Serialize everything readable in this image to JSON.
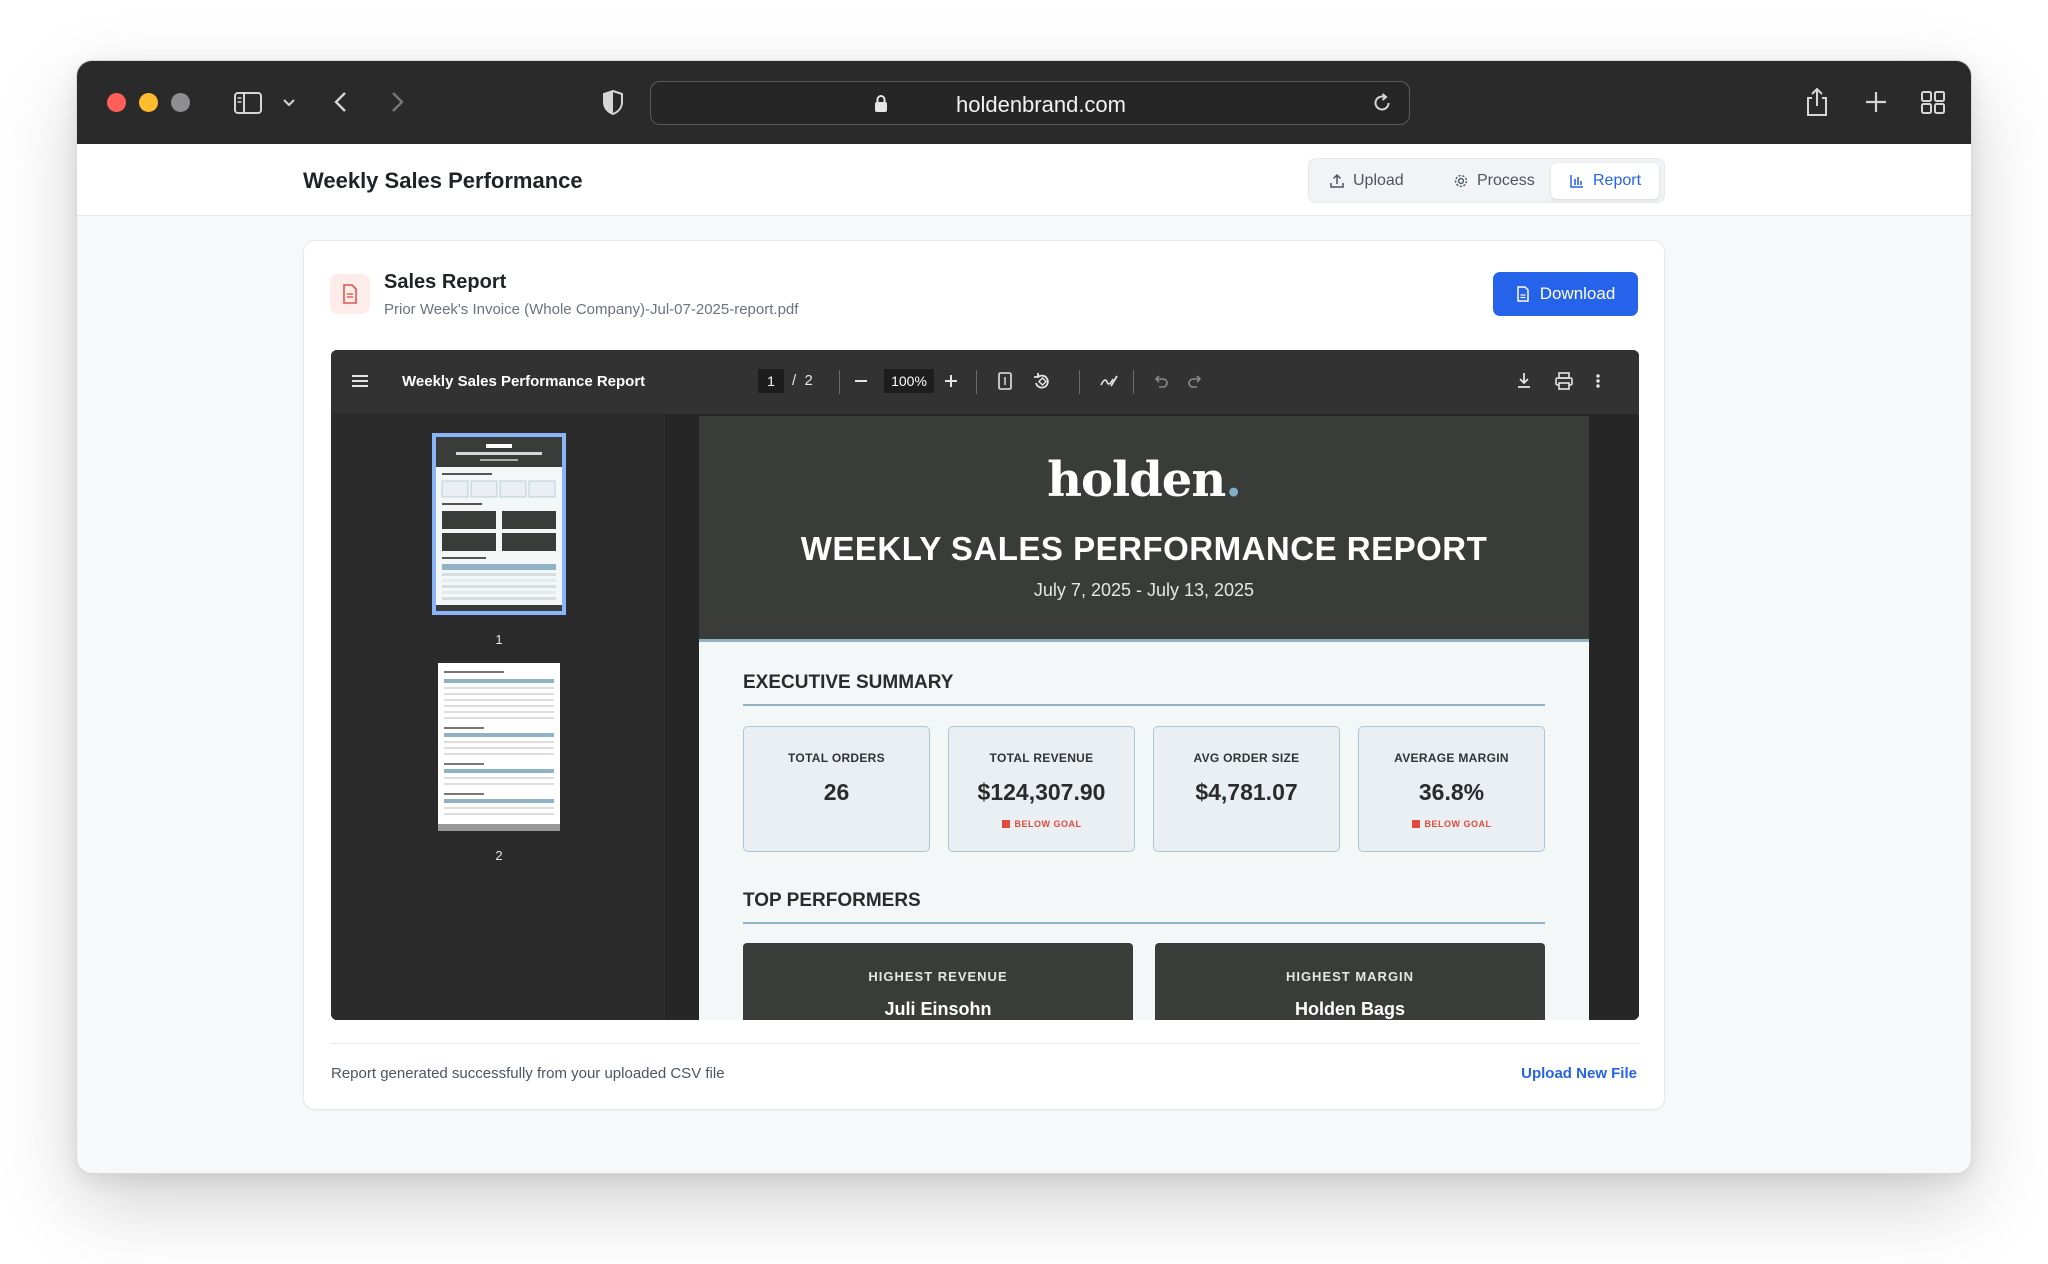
{
  "browser": {
    "url": "holdenbrand.com"
  },
  "app": {
    "title": "Weekly Sales Performance",
    "steps": [
      {
        "label": "Upload",
        "icon": "upload-icon"
      },
      {
        "label": "Process",
        "icon": "gear-icon"
      },
      {
        "label": "Report",
        "icon": "bar-chart-icon",
        "active": true
      }
    ]
  },
  "card": {
    "title": "Sales Report",
    "filename": "Prior Week's Invoice (Whole Company)-Jul-07-2025-report.pdf",
    "download_label": "Download"
  },
  "viewer": {
    "doc_title": "Weekly Sales Performance Report",
    "current_page": "1",
    "page_separator": "/",
    "total_pages": "2",
    "zoom": "100%",
    "thumbnails": [
      "1",
      "2"
    ]
  },
  "report": {
    "logo": "holden",
    "logo_dot": ".",
    "title": "WEEKLY SALES PERFORMANCE REPORT",
    "date_range": "July 7, 2025 - July 13, 2025",
    "executive_summary": "EXECUTIVE SUMMARY",
    "kpis": [
      {
        "label": "TOTAL ORDERS",
        "value": "26",
        "badge": ""
      },
      {
        "label": "TOTAL REVENUE",
        "value": "$124,307.90",
        "badge": "BELOW GOAL"
      },
      {
        "label": "AVG ORDER SIZE",
        "value": "$4,781.07",
        "badge": ""
      },
      {
        "label": "AVERAGE MARGIN",
        "value": "36.8%",
        "badge": "BELOW GOAL"
      }
    ],
    "top_performers": "TOP PERFORMERS",
    "performers": [
      {
        "label": "HIGHEST REVENUE",
        "value": "Juli Einsohn"
      },
      {
        "label": "HIGHEST MARGIN",
        "value": "Holden Bags"
      }
    ]
  },
  "footer": {
    "message": "Report generated successfully from your uploaded CSV file",
    "link": "Upload New File"
  },
  "colors": {
    "accent": "#2563eb",
    "alert": "#e04a3f",
    "report_dark": "#3a3c3a",
    "report_rule": "#8fb3c4"
  }
}
